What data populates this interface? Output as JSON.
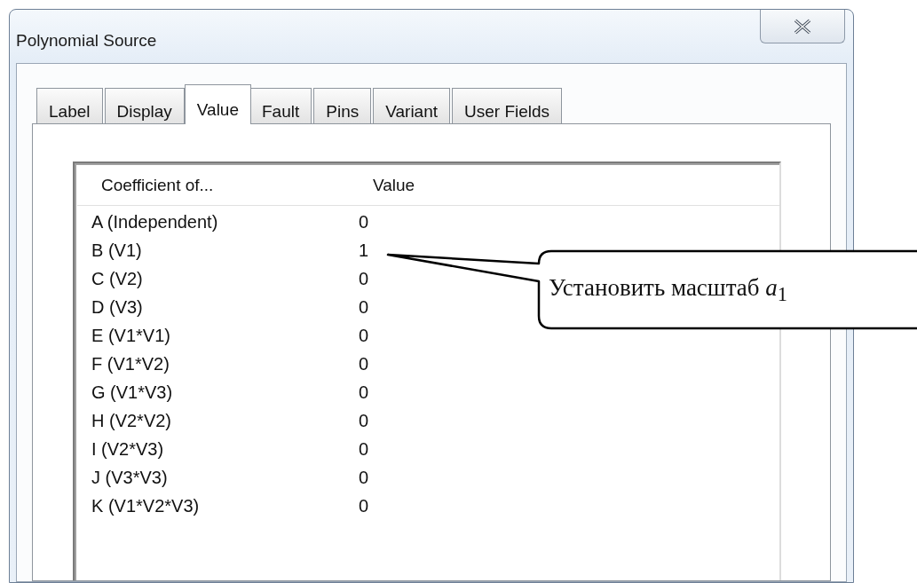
{
  "window": {
    "title": "Polynomial Source"
  },
  "tabs": [
    {
      "label": "Label",
      "selected": false
    },
    {
      "label": "Display",
      "selected": false
    },
    {
      "label": "Value",
      "selected": true
    },
    {
      "label": "Fault",
      "selected": false
    },
    {
      "label": "Pins",
      "selected": false
    },
    {
      "label": "Variant",
      "selected": false
    },
    {
      "label": "User Fields",
      "selected": false
    }
  ],
  "coefficients_table": {
    "columns": [
      "Coefficient of...",
      "Value"
    ],
    "rows": [
      {
        "coefficient": "A (Independent)",
        "value": "0"
      },
      {
        "coefficient": "B (V1)",
        "value": "1"
      },
      {
        "coefficient": "C (V2)",
        "value": "0"
      },
      {
        "coefficient": "D (V3)",
        "value": "0"
      },
      {
        "coefficient": "E (V1*V1)",
        "value": "0"
      },
      {
        "coefficient": "F (V1*V2)",
        "value": "0"
      },
      {
        "coefficient": "G (V1*V3)",
        "value": "0"
      },
      {
        "coefficient": "H (V2*V2)",
        "value": "0"
      },
      {
        "coefficient": "I (V2*V3)",
        "value": "0"
      },
      {
        "coefficient": "J (V3*V3)",
        "value": "0"
      },
      {
        "coefficient": "K (V1*V2*V3)",
        "value": "0"
      }
    ]
  },
  "callout": {
    "text": "Установить масштаб *a*$_{1}$"
  }
}
